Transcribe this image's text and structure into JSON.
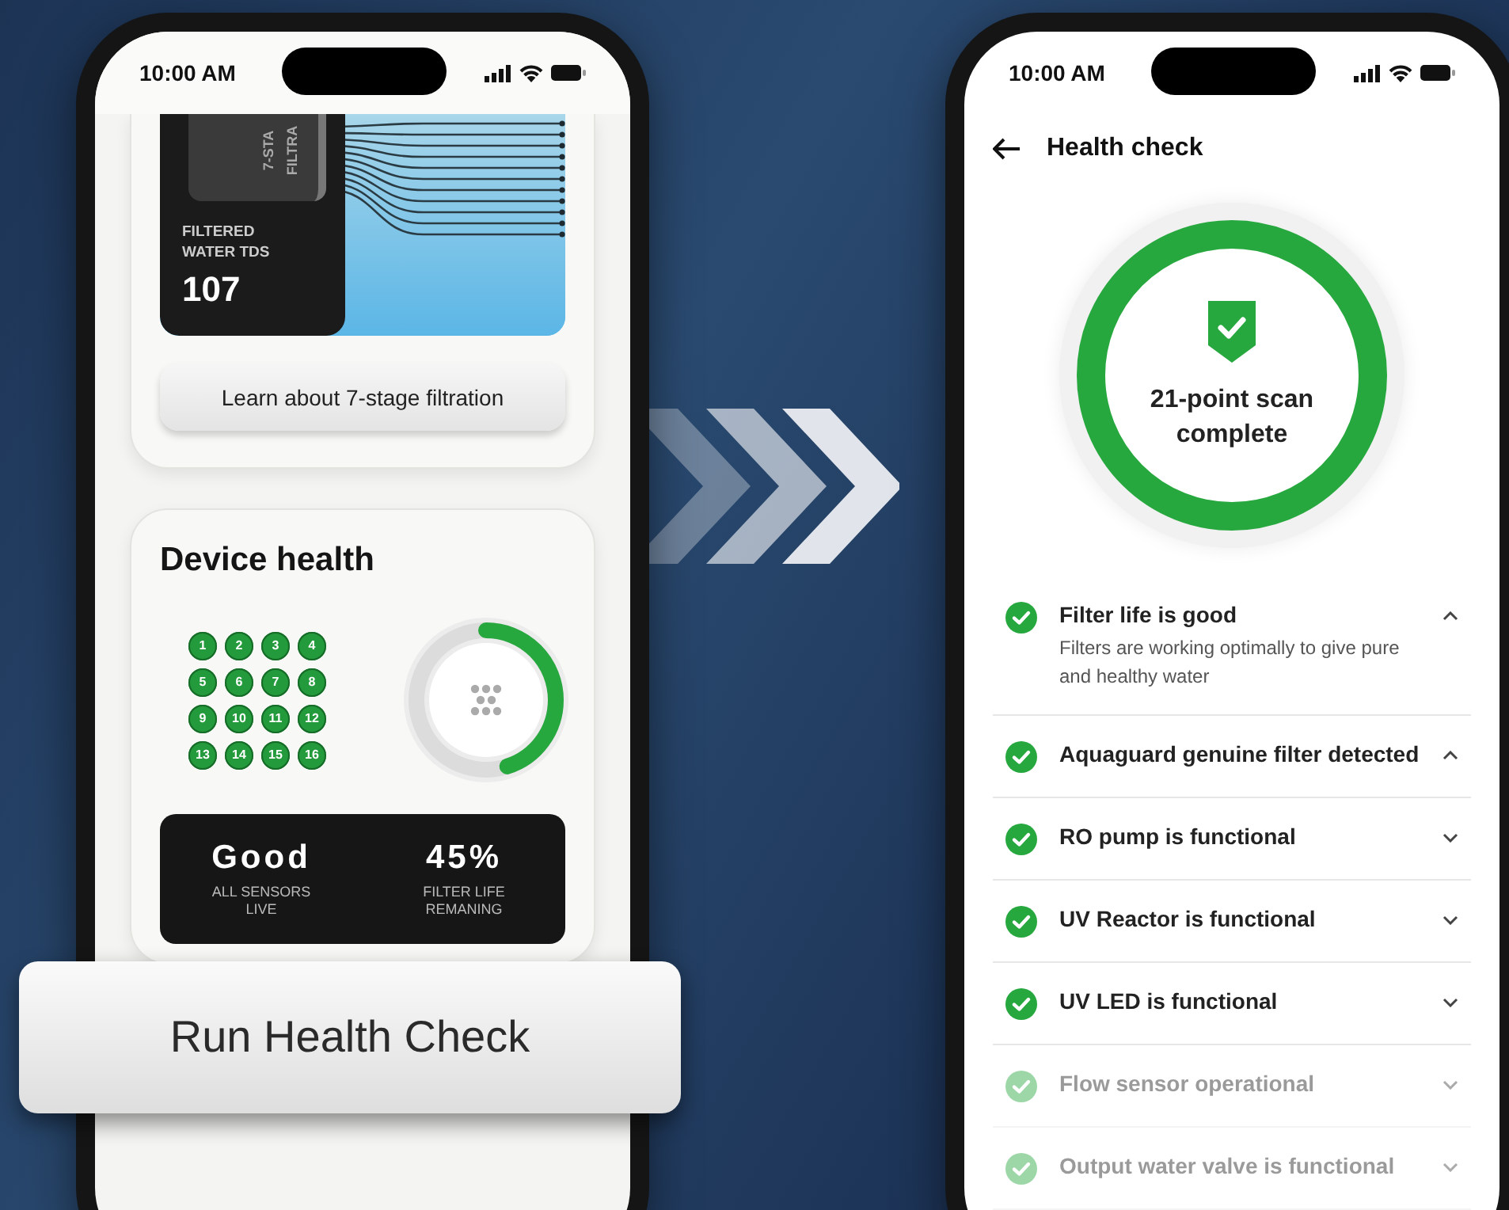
{
  "left_phone": {
    "status_time": "10:00 AM",
    "filtration_card": {
      "illustration_labels": [
        "7-STA",
        "FILTRA"
      ],
      "tds_label": "FILTERED WATER TDS",
      "tds_value": "107",
      "button": "Learn about 7-stage filtration"
    },
    "device_health": {
      "title": "Device health",
      "sensors": [
        "1",
        "2",
        "3",
        "4",
        "5",
        "6",
        "7",
        "8",
        "9",
        "10",
        "11",
        "12",
        "13",
        "14",
        "15",
        "16"
      ],
      "filter_ring": {
        "level": 0.45
      },
      "stats": [
        {
          "value": "Good",
          "label": "ALL SENSORS LIVE"
        },
        {
          "value": "45%",
          "label": "FILTER LIFE REMANING"
        }
      ]
    }
  },
  "run_button": "Run Health Check",
  "right_phone": {
    "status_time": "10:00 AM",
    "title": "Health check",
    "scan_text": "21-point scan complete",
    "checks": [
      {
        "title": "Filter life is good",
        "description": "Filters are working optimally to give pure and healthy water",
        "expanded": true,
        "faded": false
      },
      {
        "title": "Aquaguard genuine filter detected",
        "expanded": true,
        "faded": false
      },
      {
        "title": "RO pump is functional",
        "expanded": false,
        "faded": false
      },
      {
        "title": "UV Reactor is functional",
        "expanded": false,
        "faded": false
      },
      {
        "title": "UV LED is functional",
        "expanded": false,
        "faded": false
      },
      {
        "title": "Flow sensor operational",
        "expanded": false,
        "faded": true
      },
      {
        "title": "Output water valve is functional",
        "expanded": false,
        "faded": true
      }
    ]
  }
}
